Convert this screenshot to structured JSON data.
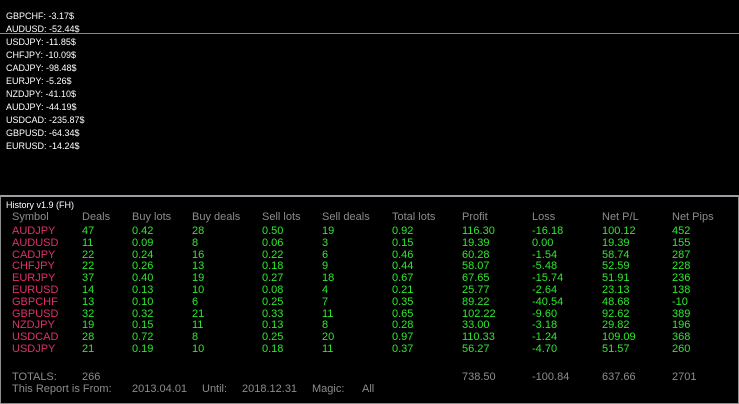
{
  "chart_lines": [
    "GBPCHF: -3.17$",
    "AUDUSD: -52.44$",
    "USDJPY: -11.85$",
    "CHFJPY: -10.09$",
    "CADJPY: -98.48$",
    "EURJPY: -5.26$",
    "NZDJPY: -41.10$",
    "AUDJPY: -44.19$",
    "USDCAD: -235.87$",
    "GBPUSD: -64.34$",
    "EURUSD: -14.24$"
  ],
  "panel_title": "History v1.9 (FH)",
  "headers": [
    "Symbol",
    "Deals",
    "Buy lots",
    "Buy deals",
    "Sell lots",
    "Sell deals",
    "Total lots",
    "Profit",
    "Loss",
    "Net P/L",
    "Net Pips"
  ],
  "rows": [
    [
      "AUDJPY",
      "47",
      "0.42",
      "28",
      "0.50",
      "19",
      "0.92",
      "116.30",
      "-16.18",
      "100.12",
      "452"
    ],
    [
      "AUDUSD",
      "11",
      "0.09",
      "8",
      "0.06",
      "3",
      "0.15",
      "19.39",
      "0.00",
      "19.39",
      "155"
    ],
    [
      "CADJPY",
      "22",
      "0.24",
      "16",
      "0.22",
      "6",
      "0.46",
      "60.28",
      "-1.54",
      "58.74",
      "287"
    ],
    [
      "CHFJPY",
      "22",
      "0.26",
      "13",
      "0.18",
      "9",
      "0.44",
      "58.07",
      "-5.48",
      "52.59",
      "228"
    ],
    [
      "EURJPY",
      "37",
      "0.40",
      "19",
      "0.27",
      "18",
      "0.67",
      "67.65",
      "-15.74",
      "51.91",
      "236"
    ],
    [
      "EURUSD",
      "14",
      "0.13",
      "10",
      "0.08",
      "4",
      "0.21",
      "25.77",
      "-2.64",
      "23.13",
      "138"
    ],
    [
      "GBPCHF",
      "13",
      "0.10",
      "6",
      "0.25",
      "7",
      "0.35",
      "89.22",
      "-40.54",
      "48.68",
      "-10"
    ],
    [
      "GBPUSD",
      "32",
      "0.32",
      "21",
      "0.33",
      "11",
      "0.65",
      "102.22",
      "-9.60",
      "92.62",
      "389"
    ],
    [
      "NZDJPY",
      "19",
      "0.15",
      "11",
      "0.13",
      "8",
      "0.28",
      "33.00",
      "-3.18",
      "29.82",
      "196"
    ],
    [
      "USDCAD",
      "28",
      "0.72",
      "8",
      "0.25",
      "20",
      "0.97",
      "110.33",
      "-1.24",
      "109.09",
      "368"
    ],
    [
      "USDJPY",
      "21",
      "0.19",
      "10",
      "0.18",
      "11",
      "0.37",
      "56.27",
      "-4.70",
      "51.57",
      "260"
    ]
  ],
  "totals": {
    "label": "TOTALS:",
    "deals": "266",
    "profit": "738.50",
    "loss": "-100.84",
    "net": "637.66",
    "pips": "2701"
  },
  "report": {
    "from_label": "This Report is From:",
    "from_date": "2013.04.01",
    "until_label": "Until:",
    "until_date": "2018.12.31",
    "magic_label": "Magic:",
    "magic_value": "All"
  },
  "colors": {
    "symbol": "#e0306a",
    "value": "#2ee82e",
    "header": "#8c8c8c"
  }
}
